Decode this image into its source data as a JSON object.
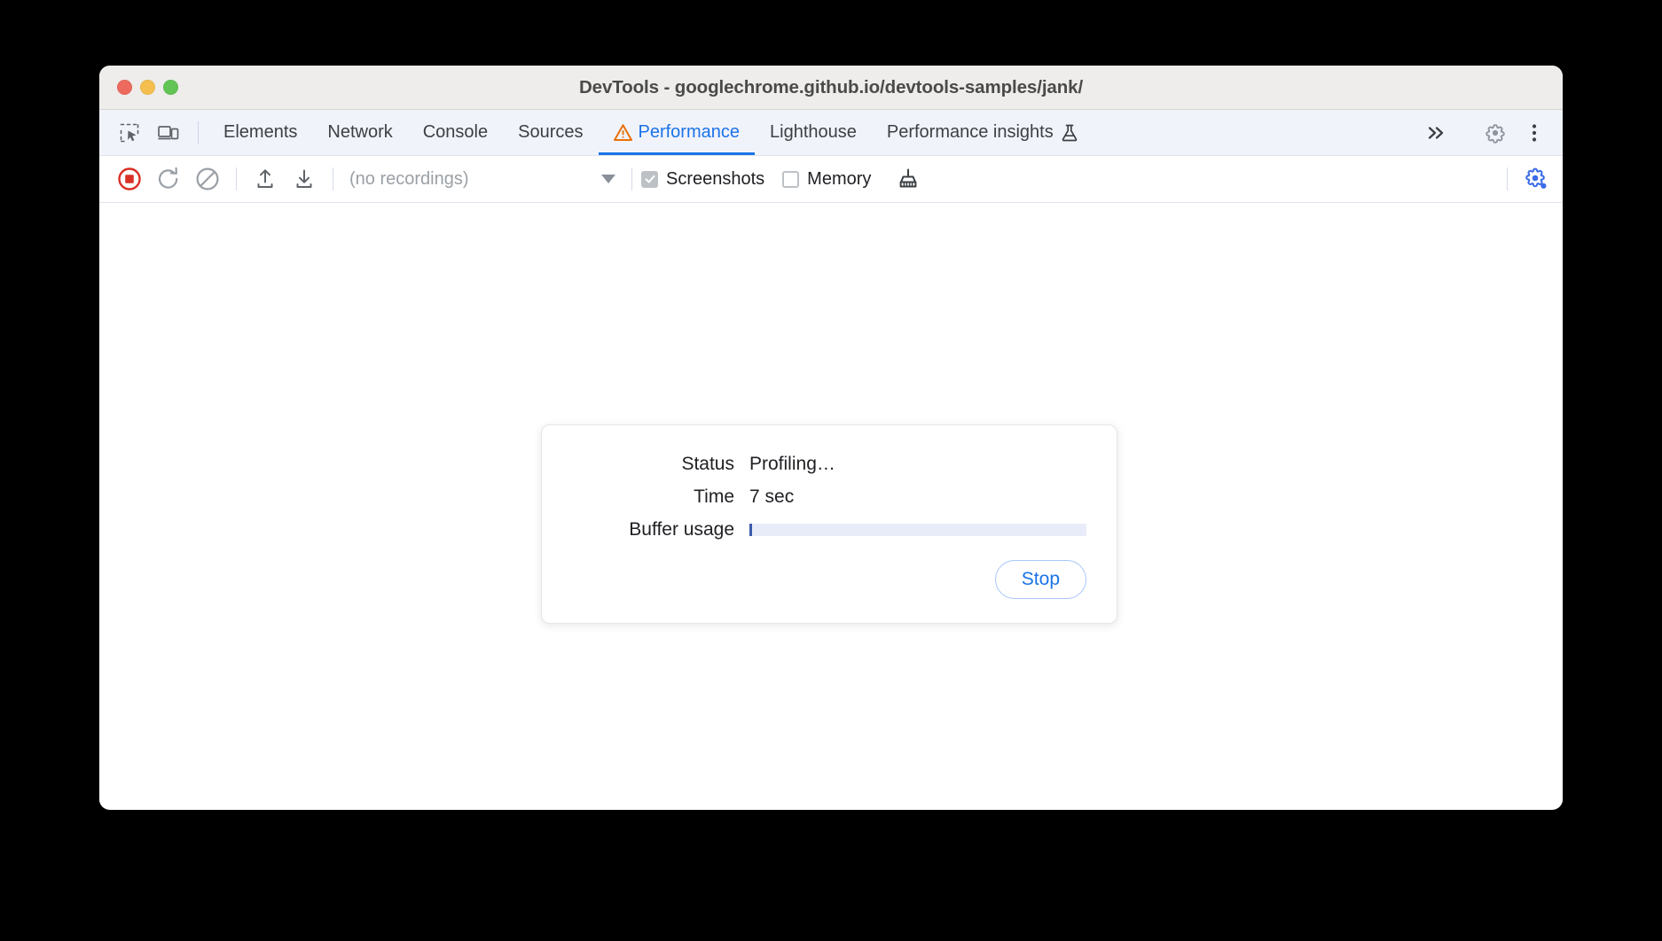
{
  "window": {
    "title": "DevTools - googlechrome.github.io/devtools-samples/jank/",
    "traffic_lights": {
      "close_label": "close-window",
      "minimize_label": "minimize-window",
      "maximize_label": "maximize-window",
      "close_color": "#ec6a5e",
      "minimize_color": "#f4bf4f",
      "maximize_color": "#61c454"
    }
  },
  "tabbar": {
    "inspect_icon": "inspect-element-icon",
    "device_icon": "device-toolbar-icon",
    "tabs": [
      {
        "label": "Elements",
        "selected": false,
        "warning": false
      },
      {
        "label": "Network",
        "selected": false,
        "warning": false
      },
      {
        "label": "Console",
        "selected": false,
        "warning": false
      },
      {
        "label": "Sources",
        "selected": false,
        "warning": false
      },
      {
        "label": "Performance",
        "selected": true,
        "warning": true
      },
      {
        "label": "Lighthouse",
        "selected": false,
        "warning": false
      },
      {
        "label": "Performance insights",
        "selected": false,
        "warning": false,
        "experiment": true
      }
    ],
    "more_tabs_icon": "chevron-double-right-icon",
    "settings_icon": "gear-icon",
    "menu_icon": "more-vertical-icon",
    "accent_color": "#1a73e8",
    "warning_color": "#e8710a"
  },
  "toolbar": {
    "record_icon": "record-stop-icon",
    "record_color": "#d93025",
    "reload_icon": "reload-and-record-icon",
    "clear_icon": "clear-recording-icon",
    "upload_icon": "load-profile-icon",
    "download_icon": "save-profile-icon",
    "recordings_value": "(no recordings)",
    "recordings_caret_icon": "chevron-down-icon",
    "screenshots_label": "Screenshots",
    "screenshots_checked": true,
    "memory_label": "Memory",
    "memory_checked": false,
    "garbage_collect_icon": "broom-collect-garbage-icon",
    "capture_settings_icon": "capture-settings-gear-icon",
    "capture_settings_color": "#3b6ce8"
  },
  "status_dialog": {
    "rows": [
      {
        "label": "Status",
        "value": "Profiling…"
      },
      {
        "label": "Time",
        "value": "7 sec"
      }
    ],
    "buffer_label": "Buffer usage",
    "buffer_percent": 0.7,
    "buffer_track_color": "#e8ecf8",
    "buffer_fill_color": "#3b5bab",
    "stop_label": "Stop"
  }
}
